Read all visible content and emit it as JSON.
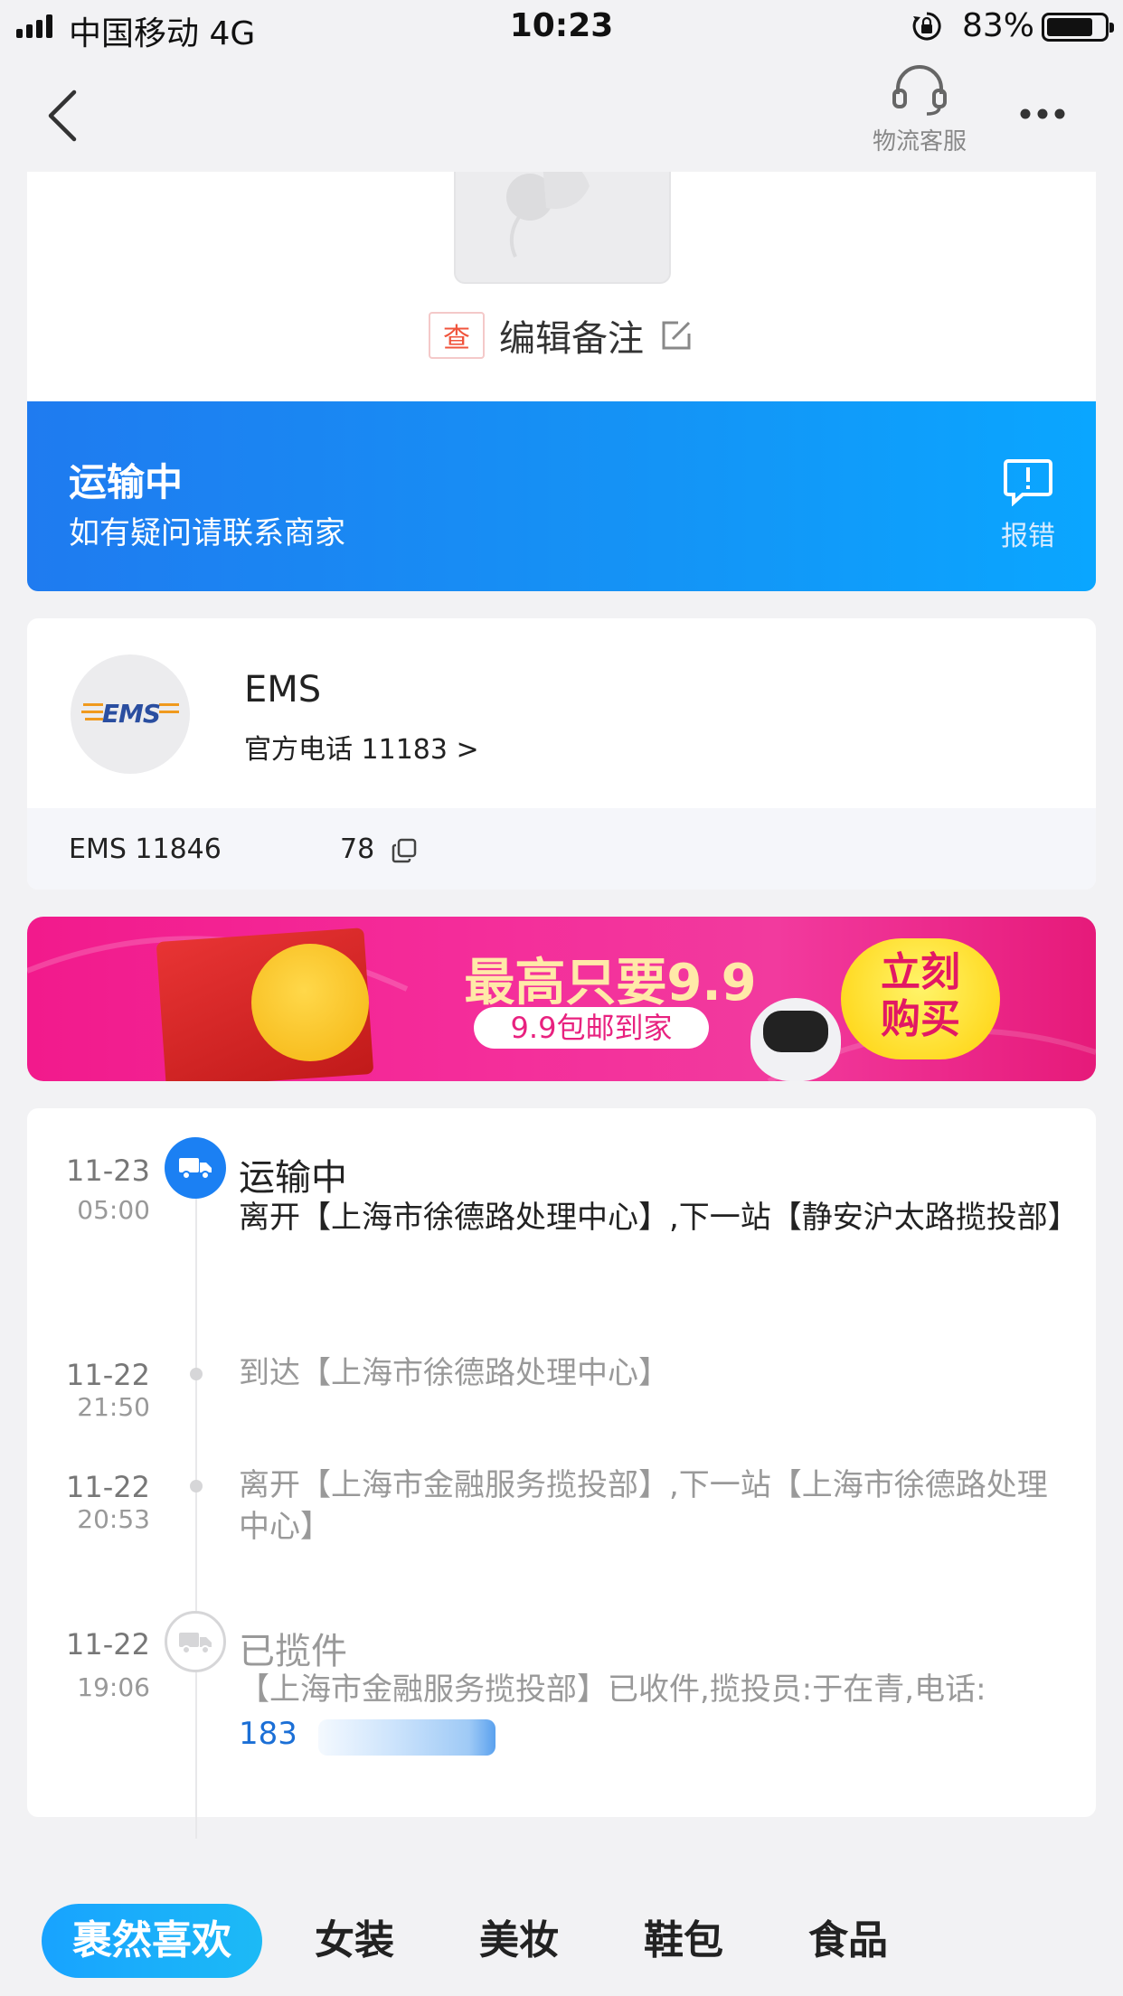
{
  "status_bar": {
    "carrier": "中国移动   4G",
    "time": "10:23",
    "battery": "83%",
    "battery_level": 0.83
  },
  "nav": {
    "service_label": "物流客服"
  },
  "package": {
    "tag": "查",
    "note_label": "编辑备注"
  },
  "status_banner": {
    "title": "运输中",
    "subtitle": "如有疑问请联系商家",
    "report_label": "报错"
  },
  "carrier": {
    "logo_text": "EMS",
    "name": "EMS",
    "phone": "官方电话 11183 >",
    "tracking_prefix": "EMS 11846",
    "tracking_suffix": "78"
  },
  "ad": {
    "headline": "最高只要9.9",
    "pill": "9.9包邮到家",
    "buy_line1": "立刻",
    "buy_line2": "购买"
  },
  "timeline": [
    {
      "date": "11-23",
      "time": "05:00",
      "title": "运输中",
      "desc": "离开【上海市徐德路处理中心】,下一站【静安沪太路揽投部】"
    },
    {
      "date": "11-22",
      "time": "21:50",
      "desc": "到达【上海市徐德路处理中心】"
    },
    {
      "date": "11-22",
      "time": "20:53",
      "desc": "离开【上海市金融服务揽投部】,下一站【上海市徐德路处理中心】"
    },
    {
      "date": "11-22",
      "time": "19:06",
      "title": "已揽件",
      "desc": "【上海市金融服务揽投部】已收件,揽投员:于在青,电话:",
      "phone": "183"
    }
  ],
  "tabs": [
    "裹然喜欢",
    "女装",
    "美妆",
    "鞋包",
    "食品"
  ],
  "colors": {
    "accent_blue": "#1b80f3",
    "banner_gradient_start": "#1f7bf0",
    "banner_gradient_end": "#0aa6ff",
    "ad_pink": "#f21a8c",
    "tag_red": "#f0543c"
  }
}
